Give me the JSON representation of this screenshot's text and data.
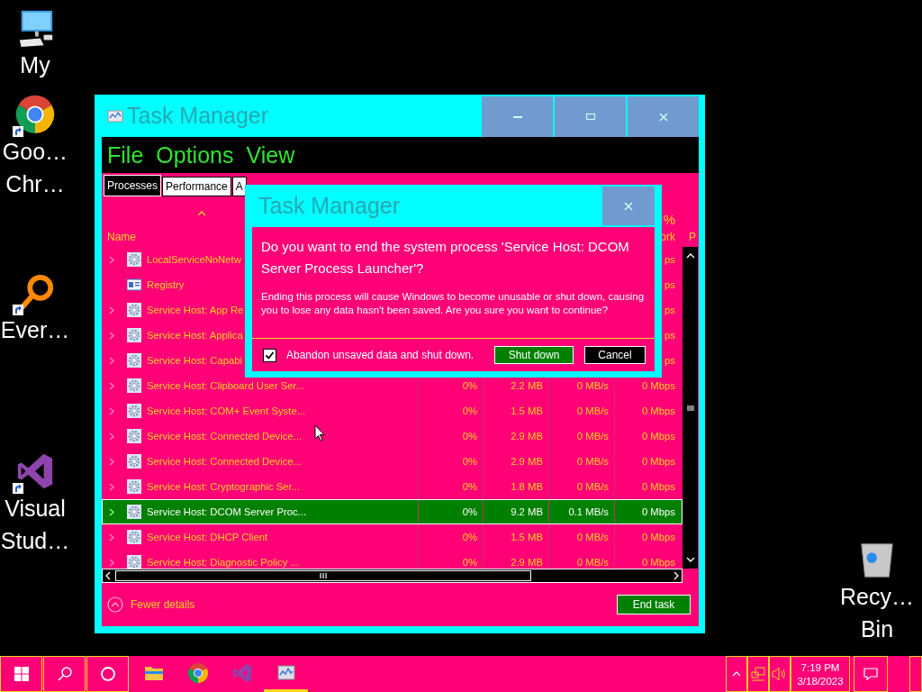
{
  "desktop_icons": [
    {
      "kind": "computer",
      "shortcut": false,
      "lines": [
        "My"
      ]
    },
    {
      "kind": "chrome",
      "shortcut": true,
      "lines": [
        "Goo…",
        "Chr…"
      ]
    },
    {
      "kind": "everything",
      "shortcut": true,
      "lines": [
        "Ever…"
      ]
    },
    {
      "kind": "visual_studio",
      "shortcut": true,
      "lines": [
        "Visual",
        "Stud…"
      ]
    },
    {
      "kind": "recycle_bin",
      "shortcut": false,
      "lines": [
        "Recy…",
        "Bin"
      ]
    }
  ],
  "window": {
    "title": "Task Manager",
    "menu": [
      "File",
      "Options",
      "View"
    ],
    "tabs": [
      {
        "label": "Processes",
        "selected": true
      },
      {
        "label": "Performance",
        "selected": false
      },
      {
        "label": "A",
        "selected": false
      }
    ],
    "header": {
      "name": "Name",
      "network_percent": "%",
      "network_label": "ork",
      "column_6": "P"
    },
    "rows": [
      {
        "kind": "service",
        "expandable": true,
        "selected": false,
        "name": "LocalServiceNoNetw",
        "network": "ps"
      },
      {
        "kind": "app",
        "expandable": false,
        "selected": false,
        "name": "Registry",
        "network": "ps"
      },
      {
        "kind": "service",
        "expandable": true,
        "selected": false,
        "name": "Service Host: App Re",
        "network": "ps"
      },
      {
        "kind": "service",
        "expandable": true,
        "selected": false,
        "name": "Service Host: Applica",
        "network": "ps"
      },
      {
        "kind": "service",
        "expandable": true,
        "selected": false,
        "name": "Service Host: Capabi",
        "network": "ps"
      },
      {
        "kind": "service",
        "expandable": true,
        "selected": false,
        "name": "Service Host: Clipboard User Ser...",
        "cpu": "0%",
        "memory": "2.2 MB",
        "disk": "0 MB/s",
        "network": "0 Mbps"
      },
      {
        "kind": "service",
        "expandable": true,
        "selected": false,
        "name": "Service Host: COM+ Event Syste...",
        "cpu": "0%",
        "memory": "1.5 MB",
        "disk": "0 MB/s",
        "network": "0 Mbps"
      },
      {
        "kind": "service",
        "expandable": true,
        "selected": false,
        "name": "Service Host: Connected Device...",
        "cpu": "0%",
        "memory": "2.9 MB",
        "disk": "0 MB/s",
        "network": "0 Mbps"
      },
      {
        "kind": "service",
        "expandable": true,
        "selected": false,
        "name": "Service Host: Connected Device...",
        "cpu": "0%",
        "memory": "2.9 MB",
        "disk": "0 MB/s",
        "network": "0 Mbps"
      },
      {
        "kind": "service",
        "expandable": true,
        "selected": false,
        "name": "Service Host: Cryptographic Ser...",
        "cpu": "0%",
        "memory": "1.8 MB",
        "disk": "0 MB/s",
        "network": "0 Mbps"
      },
      {
        "kind": "service",
        "expandable": true,
        "selected": true,
        "name": "Service Host: DCOM Server Proc...",
        "cpu": "0%",
        "memory": "9.2 MB",
        "disk": "0.1 MB/s",
        "network": "0 Mbps"
      },
      {
        "kind": "service",
        "expandable": true,
        "selected": false,
        "name": "Service Host: DHCP Client",
        "cpu": "0%",
        "memory": "1.5 MB",
        "disk": "0 MB/s",
        "network": "0 Mbps"
      },
      {
        "kind": "service",
        "expandable": true,
        "selected": false,
        "name": "Service Host: Diagnostic Policy ...",
        "cpu": "0%",
        "memory": "2.9 MB",
        "disk": "0 MB/s",
        "network": "0 Mbps"
      }
    ],
    "footer": {
      "fewer_details": "Fewer details",
      "end_task": "End task"
    }
  },
  "dialog": {
    "title": "Task Manager",
    "heading": "Do you want to end the system process 'Service Host: DCOM Server Process Launcher'?",
    "message": "Ending this process will cause Windows to become unusable or shut down, causing you to lose any data hasn't been saved. Are you sure you want to continue?",
    "checkbox": {
      "label": "Abandon unsaved data and shut down.",
      "checked": true
    },
    "buttons": [
      {
        "kind": "primary",
        "label": "Shut down"
      },
      {
        "kind": "secondary",
        "label": "Cancel"
      }
    ]
  },
  "taskbar": {
    "apps": [
      {
        "kind": "explorer",
        "active": false
      },
      {
        "kind": "chrome",
        "active": false
      },
      {
        "kind": "visual_studio",
        "active": false
      },
      {
        "kind": "task_manager",
        "active": true
      }
    ],
    "clock": {
      "time": "7:19 PM",
      "date": "3/18/2023"
    }
  }
}
